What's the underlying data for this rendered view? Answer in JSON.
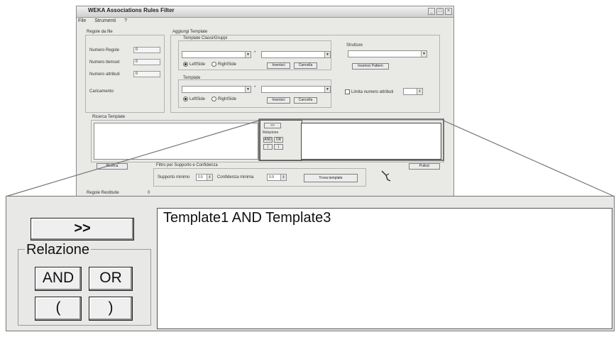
{
  "window": {
    "title": "WEKA Associations Rules Filter",
    "menu": [
      "File",
      "Strumenti",
      "?"
    ]
  },
  "regole": {
    "group_label": "Regole da file",
    "numero_regole": "Numero Regole",
    "numero_regole_val": "0",
    "numero_itemset": "Numero itemset",
    "numero_itemset_val": "0",
    "numero_attributi": "Numero attributi",
    "numero_attributi_val": "0",
    "caricamento": "Caricamento"
  },
  "aggiungi": {
    "group_label": "Aggiungi Template",
    "sottogruppo": "Template Classi/Gruppi",
    "lefthand": "LeftSide",
    "righthand": "RightSide",
    "star": "*",
    "inserisci": "Inserisci",
    "cancella": "Cancella",
    "template_label": "Template",
    "strutture_label": "Strutture",
    "inserisci_pattern": "Inserisci Pattern",
    "limita_numero": "Limita numero attributi"
  },
  "ricerca": {
    "label": "Ricerca Template",
    "button_left": "Ricerca",
    "mini_arrow": ">>",
    "mini_relazione": "Relazione",
    "mini_and": "AND",
    "mini_or": "OR",
    "mini_lp": "(",
    "mini_rp": ")"
  },
  "filtro": {
    "label": "Filtro per Supporto e Confidenza",
    "supporto": "Supporto minimo",
    "supporto_val": "0.5",
    "confidenza": "Confidenza minima",
    "confidenza_val": "0.9",
    "trova": "Trova template",
    "pulisci": "Pulisci"
  },
  "footer": {
    "regole_restituite": "Regole Restituite",
    "count": "0"
  },
  "inset": {
    "arrow_button": ">>",
    "relazione_label": "Relazione",
    "and_button": "AND",
    "or_button": "OR",
    "open_paren_button": "(",
    "close_paren_button": ")",
    "expression_text": "Template1 AND Template3"
  }
}
